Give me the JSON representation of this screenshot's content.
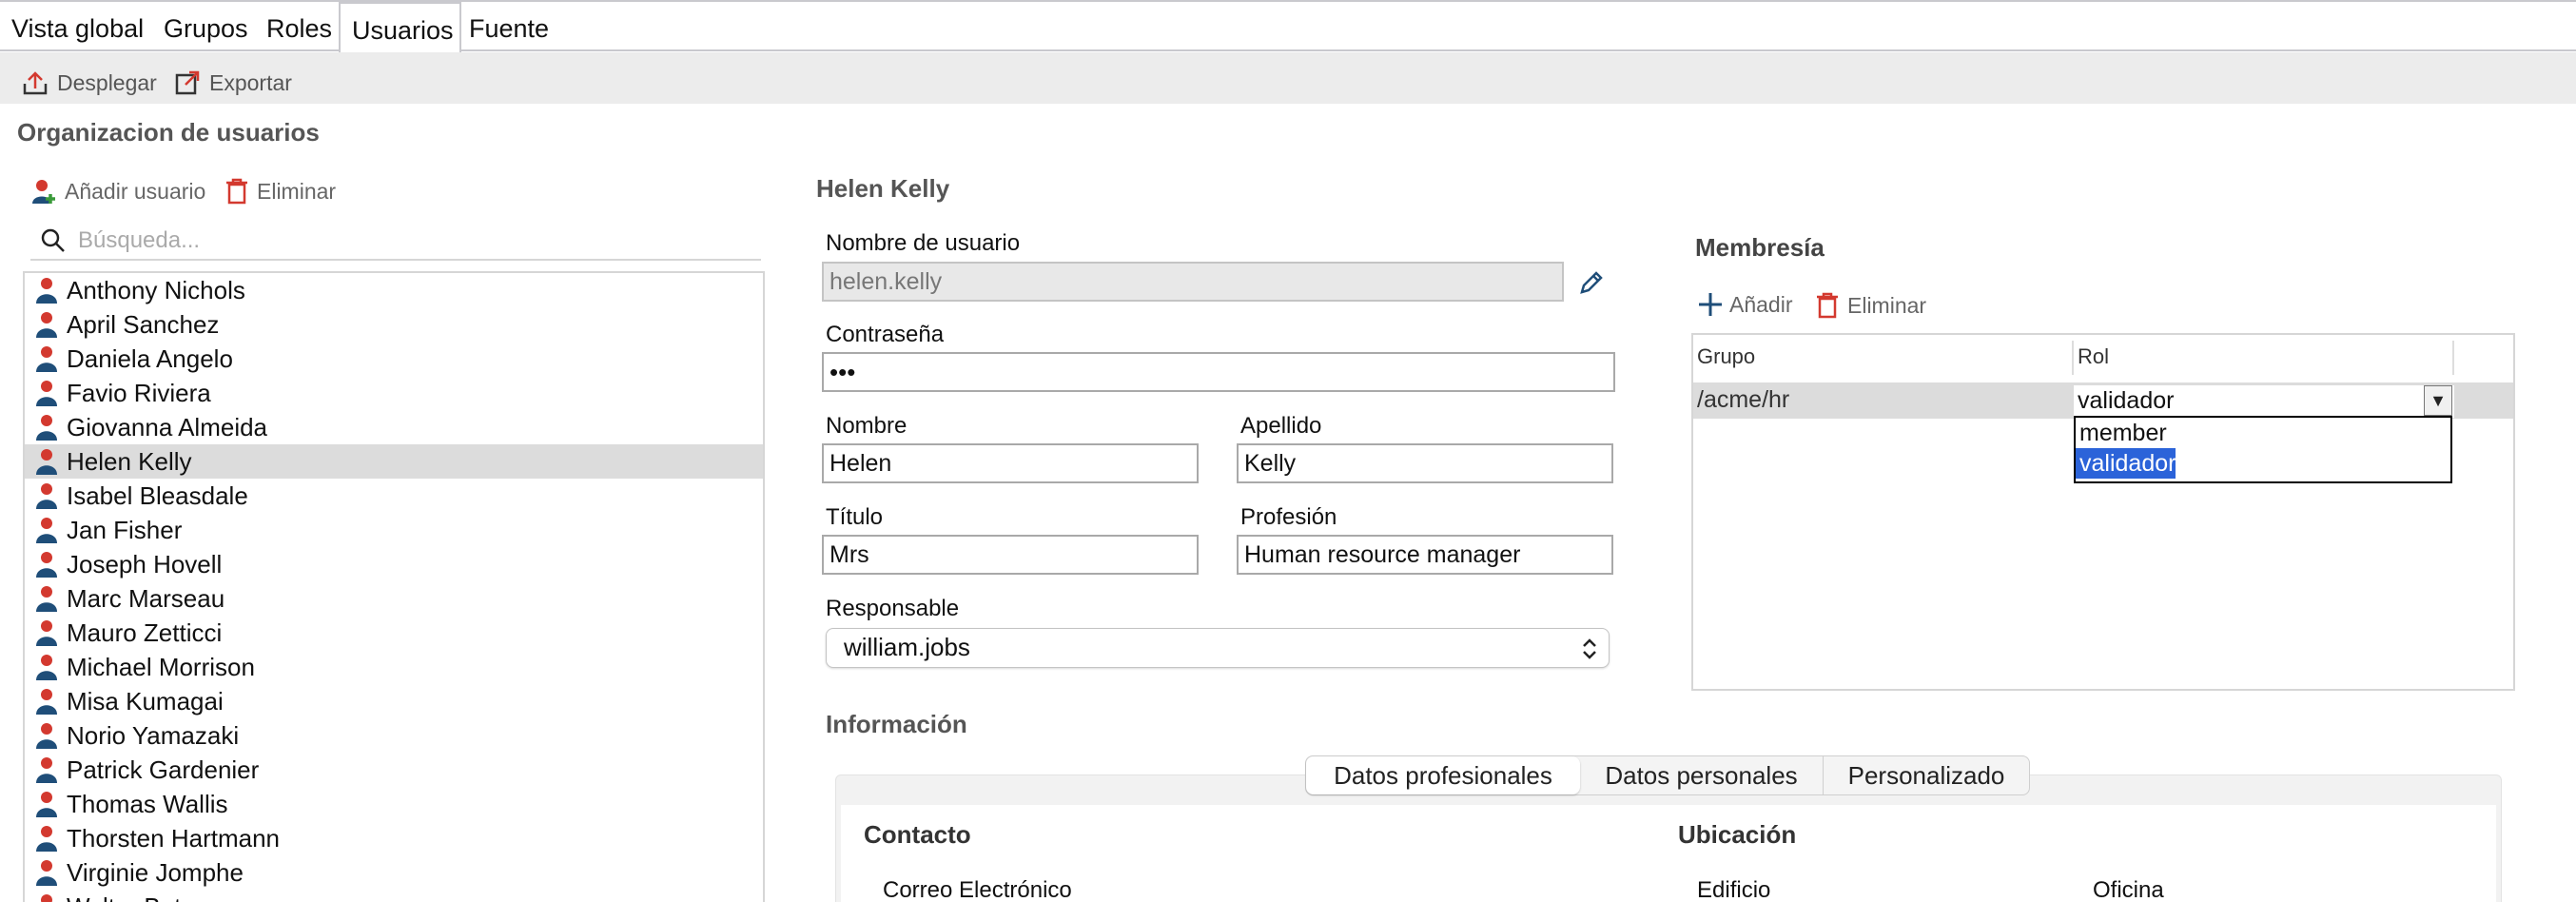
{
  "tabs": [
    "Vista global",
    "Grupos",
    "Roles",
    "Usuarios",
    "Fuente"
  ],
  "active_tab": "Usuarios",
  "toolbar": {
    "deploy_label": "Desplegar",
    "export_label": "Exportar"
  },
  "org": {
    "title": "Organizacion de usuarios",
    "add_user_label": "Añadir usuario",
    "delete_label": "Eliminar",
    "search_placeholder": "Búsqueda...",
    "users": [
      "Anthony Nichols",
      "April Sanchez",
      "Daniela Angelo",
      "Favio Riviera",
      "Giovanna Almeida",
      "Helen Kelly",
      "Isabel Bleasdale",
      "Jan Fisher",
      "Joseph Hovell",
      "Marc Marseau",
      "Mauro Zetticci",
      "Michael Morrison",
      "Misa Kumagai",
      "Norio Yamazaki",
      "Patrick Gardenier",
      "Thomas Wallis",
      "Thorsten Hartmann",
      "Virginie Jomphe",
      "Walter Bates"
    ],
    "selected_user": "Helen Kelly"
  },
  "detail": {
    "heading": "Helen Kelly",
    "username_label": "Nombre de usuario",
    "username_value": "helen.kelly",
    "password_label": "Contraseña",
    "password_value": "•••",
    "first_name_label": "Nombre",
    "first_name_value": "Helen",
    "last_name_label": "Apellido",
    "last_name_value": "Kelly",
    "title_label": "Título",
    "title_value": "Mrs",
    "job_label": "Profesión",
    "job_value": "Human resource manager",
    "manager_label": "Responsable",
    "manager_value": "william.jobs",
    "info_title": "Información",
    "subtabs": [
      "Datos profesionales",
      "Datos personales",
      "Personalizado"
    ],
    "contact_title": "Contacto",
    "location_title": "Ubicación",
    "email_label": "Correo Electrónico",
    "building_label": "Edificio",
    "office_label": "Oficina"
  },
  "membership": {
    "title": "Membresía",
    "add_label": "Añadir",
    "delete_label": "Eliminar",
    "col_group": "Grupo",
    "col_role": "Rol",
    "row_group": "/acme/hr",
    "row_role": "validador",
    "role_options": [
      "member",
      "validador"
    ],
    "selected_option": "validador"
  },
  "colors": {
    "selection": "#2b63d9",
    "accent_red": "#d3392f",
    "icon_blue": "#1f4e79"
  }
}
